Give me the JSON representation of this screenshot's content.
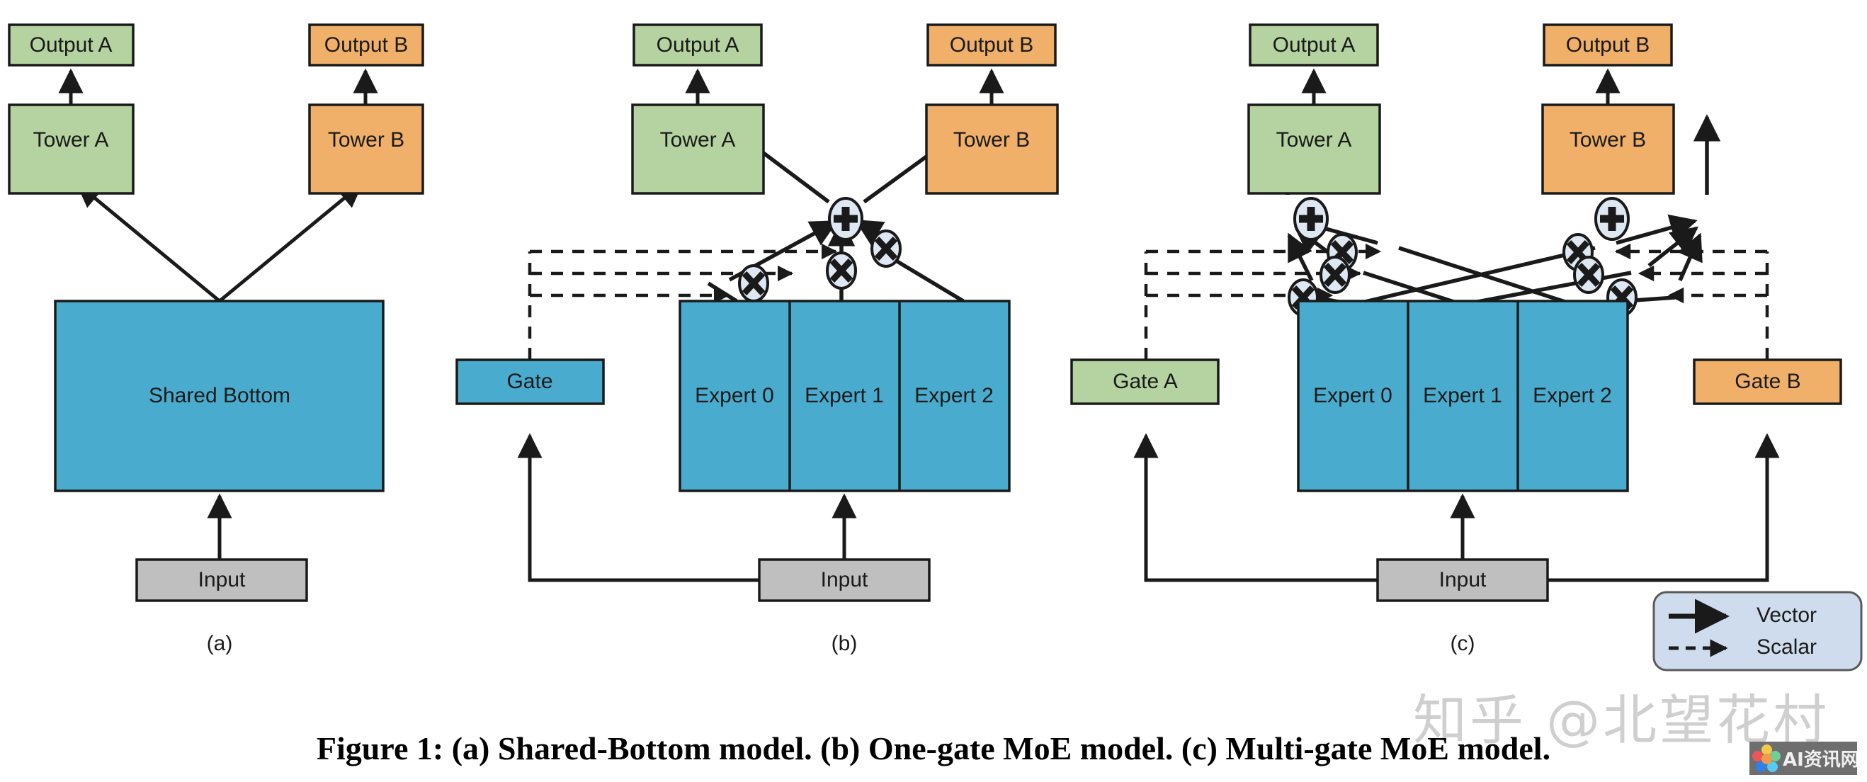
{
  "figure": {
    "caption": "Figure 1: (a) Shared-Bottom model. (b) One-gate MoE model. (c) Multi-gate MoE model."
  },
  "colors": {
    "green": "#b5d3a0",
    "orange": "#f0b06a",
    "blue": "#49abcd",
    "gray": "#bfbfbf",
    "legend_bg": "#cfdced",
    "stroke": "#1a1a1a",
    "node_fill": "#dde8f2",
    "watermark": "#cfcfcf"
  },
  "panels": [
    {
      "id": "a",
      "label": "(a)",
      "nodes": {
        "output_a": "Output A",
        "tower_a": "Tower A",
        "output_b": "Output B",
        "tower_b": "Tower B",
        "shared_bottom": "Shared Bottom",
        "input": "Input"
      }
    },
    {
      "id": "b",
      "label": "(b)",
      "nodes": {
        "output_a": "Output A",
        "tower_a": "Tower A",
        "output_b": "Output B",
        "tower_b": "Tower B",
        "gate": "Gate",
        "experts": [
          "Expert 0",
          "Expert 1",
          "Expert 2"
        ],
        "input": "Input",
        "sum_symbol": "+",
        "mul_symbol": "×"
      }
    },
    {
      "id": "c",
      "label": "(c)",
      "nodes": {
        "output_a": "Output A",
        "tower_a": "Tower A",
        "output_b": "Output B",
        "tower_b": "Tower B",
        "gate_a": "Gate A",
        "gate_b": "Gate B",
        "experts": [
          "Expert 0",
          "Expert 1",
          "Expert 2"
        ],
        "input": "Input",
        "sum_symbol": "+",
        "mul_symbol": "×"
      }
    }
  ],
  "legend": {
    "items": [
      {
        "label": "Vector",
        "style": "solid"
      },
      {
        "label": "Scalar",
        "style": "dashed"
      }
    ]
  },
  "watermark": {
    "text": "知乎 @北望花村",
    "badge_text": "AI资讯网"
  }
}
